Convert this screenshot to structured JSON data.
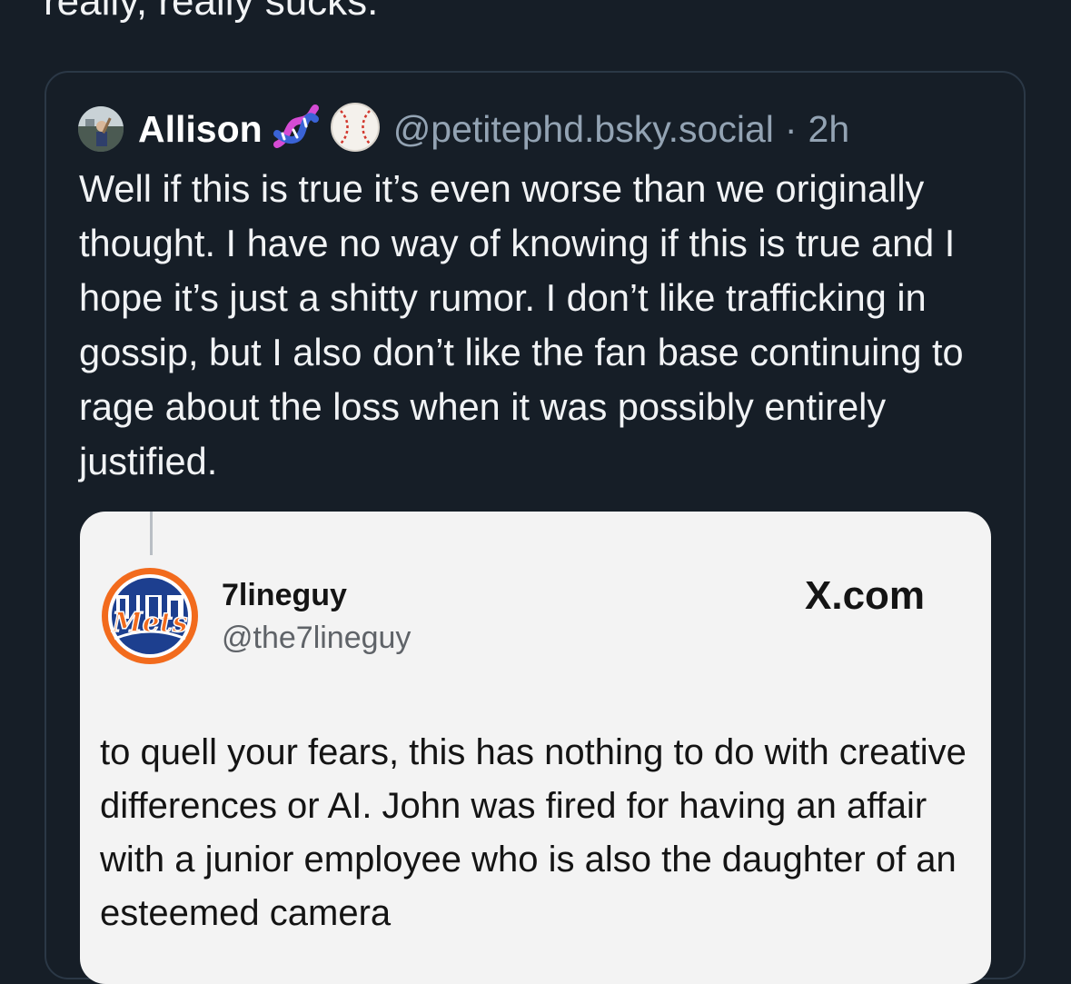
{
  "post": {
    "text_fragment": "really, really sucks."
  },
  "quoted_post": {
    "author": {
      "display_name": "Allison",
      "emojis": [
        "dna-icon",
        "baseball-icon"
      ],
      "handle": "@petitephd.bsky.social",
      "separator": "·",
      "time": "2h"
    },
    "text": "Well if this is true it’s even worse than we originally thought. I have no way of knowing if this is true and I hope it’s just a shitty rumor. I don’t like trafficking in gossip, but I also don’t like the fan base continuing to rage about the loss when it was possibly entirely justified.",
    "embed": {
      "author_name": "7lineguy",
      "author_handle": "@the7lineguy",
      "source": "X.com",
      "logo_text": "Mets",
      "text": "to quell your fears, this has nothing to do with creative differences or AI. John was fired for having an affair with a junior employee who is also the daughter of an esteemed camera"
    }
  },
  "colors": {
    "background": "#161e27",
    "card_border": "#2b3846",
    "muted_text": "#93a3b3",
    "embed_background": "#f3f3f3",
    "mets_orange": "#f26b1d",
    "mets_blue": "#1d3f8f"
  }
}
